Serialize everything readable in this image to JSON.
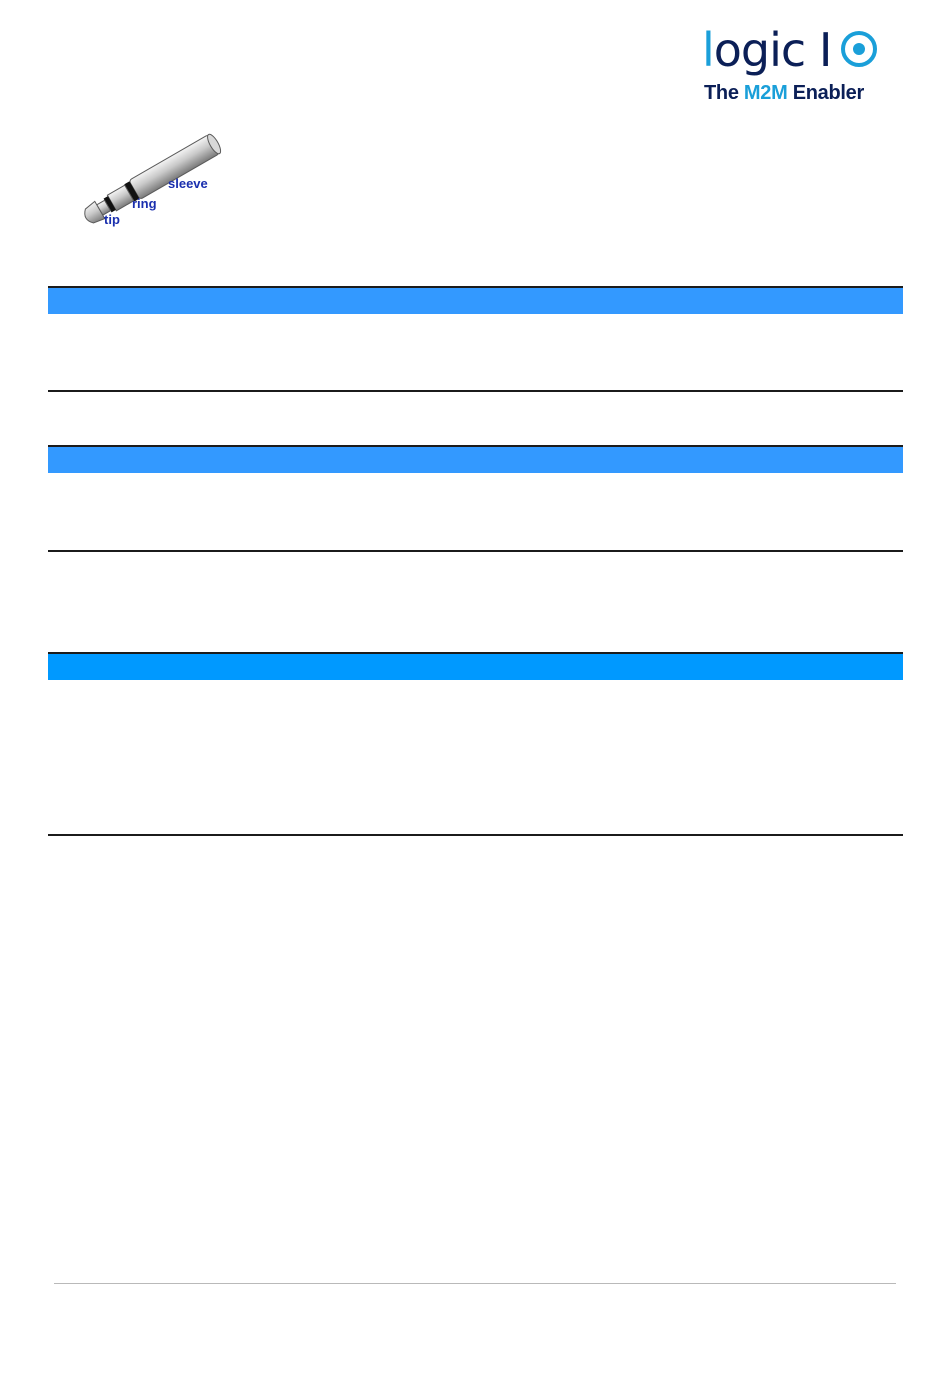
{
  "logo": {
    "wordmark_prefix": "l",
    "wordmark_rest": "ogic I",
    "tagline_pre": "The ",
    "tagline_accent": "M2M",
    "tagline_post": " Enabler",
    "colors": {
      "navy": "#0b1f57",
      "accent": "#1a9fd9"
    }
  },
  "jack_image": {
    "labels": {
      "tip": "tip",
      "ring": "ring",
      "sleeve": "sleeve"
    }
  },
  "tables": [
    {
      "header_color": "#3399ff"
    },
    {
      "header_color": "#3399ff"
    },
    {
      "header_color": "#0099ff"
    }
  ]
}
